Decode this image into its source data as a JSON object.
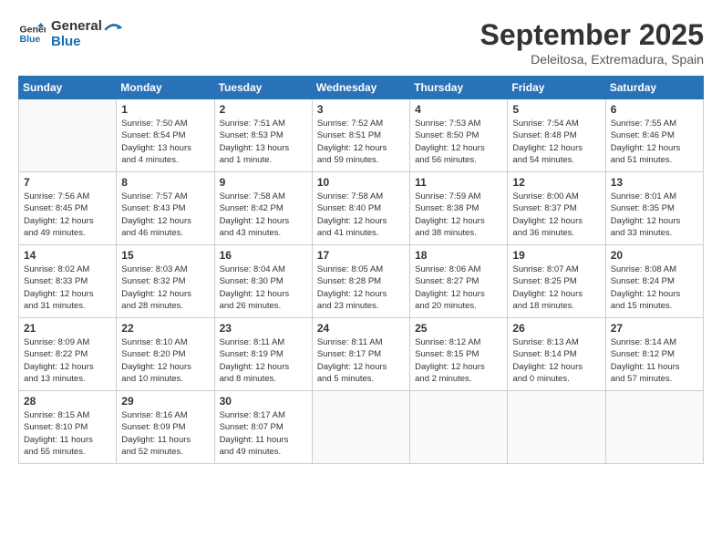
{
  "header": {
    "logo_line1": "General",
    "logo_line2": "Blue",
    "month": "September 2025",
    "location": "Deleitosa, Extremadura, Spain"
  },
  "weekdays": [
    "Sunday",
    "Monday",
    "Tuesday",
    "Wednesday",
    "Thursday",
    "Friday",
    "Saturday"
  ],
  "weeks": [
    [
      {
        "day": "",
        "info": ""
      },
      {
        "day": "1",
        "info": "Sunrise: 7:50 AM\nSunset: 8:54 PM\nDaylight: 13 hours\nand 4 minutes."
      },
      {
        "day": "2",
        "info": "Sunrise: 7:51 AM\nSunset: 8:53 PM\nDaylight: 13 hours\nand 1 minute."
      },
      {
        "day": "3",
        "info": "Sunrise: 7:52 AM\nSunset: 8:51 PM\nDaylight: 12 hours\nand 59 minutes."
      },
      {
        "day": "4",
        "info": "Sunrise: 7:53 AM\nSunset: 8:50 PM\nDaylight: 12 hours\nand 56 minutes."
      },
      {
        "day": "5",
        "info": "Sunrise: 7:54 AM\nSunset: 8:48 PM\nDaylight: 12 hours\nand 54 minutes."
      },
      {
        "day": "6",
        "info": "Sunrise: 7:55 AM\nSunset: 8:46 PM\nDaylight: 12 hours\nand 51 minutes."
      }
    ],
    [
      {
        "day": "7",
        "info": "Sunrise: 7:56 AM\nSunset: 8:45 PM\nDaylight: 12 hours\nand 49 minutes."
      },
      {
        "day": "8",
        "info": "Sunrise: 7:57 AM\nSunset: 8:43 PM\nDaylight: 12 hours\nand 46 minutes."
      },
      {
        "day": "9",
        "info": "Sunrise: 7:58 AM\nSunset: 8:42 PM\nDaylight: 12 hours\nand 43 minutes."
      },
      {
        "day": "10",
        "info": "Sunrise: 7:58 AM\nSunset: 8:40 PM\nDaylight: 12 hours\nand 41 minutes."
      },
      {
        "day": "11",
        "info": "Sunrise: 7:59 AM\nSunset: 8:38 PM\nDaylight: 12 hours\nand 38 minutes."
      },
      {
        "day": "12",
        "info": "Sunrise: 8:00 AM\nSunset: 8:37 PM\nDaylight: 12 hours\nand 36 minutes."
      },
      {
        "day": "13",
        "info": "Sunrise: 8:01 AM\nSunset: 8:35 PM\nDaylight: 12 hours\nand 33 minutes."
      }
    ],
    [
      {
        "day": "14",
        "info": "Sunrise: 8:02 AM\nSunset: 8:33 PM\nDaylight: 12 hours\nand 31 minutes."
      },
      {
        "day": "15",
        "info": "Sunrise: 8:03 AM\nSunset: 8:32 PM\nDaylight: 12 hours\nand 28 minutes."
      },
      {
        "day": "16",
        "info": "Sunrise: 8:04 AM\nSunset: 8:30 PM\nDaylight: 12 hours\nand 26 minutes."
      },
      {
        "day": "17",
        "info": "Sunrise: 8:05 AM\nSunset: 8:28 PM\nDaylight: 12 hours\nand 23 minutes."
      },
      {
        "day": "18",
        "info": "Sunrise: 8:06 AM\nSunset: 8:27 PM\nDaylight: 12 hours\nand 20 minutes."
      },
      {
        "day": "19",
        "info": "Sunrise: 8:07 AM\nSunset: 8:25 PM\nDaylight: 12 hours\nand 18 minutes."
      },
      {
        "day": "20",
        "info": "Sunrise: 8:08 AM\nSunset: 8:24 PM\nDaylight: 12 hours\nand 15 minutes."
      }
    ],
    [
      {
        "day": "21",
        "info": "Sunrise: 8:09 AM\nSunset: 8:22 PM\nDaylight: 12 hours\nand 13 minutes."
      },
      {
        "day": "22",
        "info": "Sunrise: 8:10 AM\nSunset: 8:20 PM\nDaylight: 12 hours\nand 10 minutes."
      },
      {
        "day": "23",
        "info": "Sunrise: 8:11 AM\nSunset: 8:19 PM\nDaylight: 12 hours\nand 8 minutes."
      },
      {
        "day": "24",
        "info": "Sunrise: 8:11 AM\nSunset: 8:17 PM\nDaylight: 12 hours\nand 5 minutes."
      },
      {
        "day": "25",
        "info": "Sunrise: 8:12 AM\nSunset: 8:15 PM\nDaylight: 12 hours\nand 2 minutes."
      },
      {
        "day": "26",
        "info": "Sunrise: 8:13 AM\nSunset: 8:14 PM\nDaylight: 12 hours\nand 0 minutes."
      },
      {
        "day": "27",
        "info": "Sunrise: 8:14 AM\nSunset: 8:12 PM\nDaylight: 11 hours\nand 57 minutes."
      }
    ],
    [
      {
        "day": "28",
        "info": "Sunrise: 8:15 AM\nSunset: 8:10 PM\nDaylight: 11 hours\nand 55 minutes."
      },
      {
        "day": "29",
        "info": "Sunrise: 8:16 AM\nSunset: 8:09 PM\nDaylight: 11 hours\nand 52 minutes."
      },
      {
        "day": "30",
        "info": "Sunrise: 8:17 AM\nSunset: 8:07 PM\nDaylight: 11 hours\nand 49 minutes."
      },
      {
        "day": "",
        "info": ""
      },
      {
        "day": "",
        "info": ""
      },
      {
        "day": "",
        "info": ""
      },
      {
        "day": "",
        "info": ""
      }
    ]
  ]
}
